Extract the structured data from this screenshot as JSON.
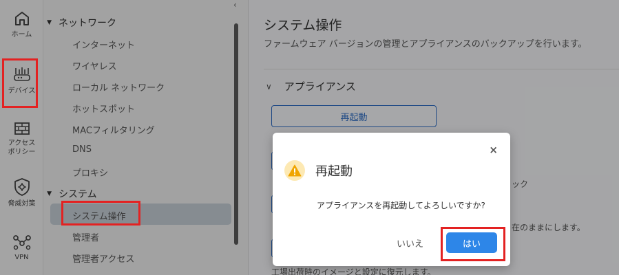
{
  "rail": {
    "items": [
      {
        "label": "ホーム",
        "icon": "home-icon"
      },
      {
        "label": "デバイス",
        "icon": "router-icon"
      },
      {
        "label": "アクセス\nポリシー",
        "label1": "アクセス",
        "label2": "ポリシー",
        "icon": "firewall-icon"
      },
      {
        "label": "脅威対策",
        "icon": "shield-icon"
      },
      {
        "label": "VPN",
        "icon": "vpn-icon"
      }
    ]
  },
  "nav": {
    "sections": [
      {
        "label": "ネットワーク",
        "items": [
          "インターネット",
          "ワイヤレス",
          "ローカル ネットワーク",
          "ホットスポット",
          "MACフィルタリング",
          "DNS",
          "プロキシ"
        ]
      },
      {
        "label": "システム",
        "items": [
          "システム操作",
          "管理者",
          "管理者アクセス"
        ]
      }
    ],
    "collapse_glyph": "‹"
  },
  "main": {
    "title": "システム操作",
    "subtitle": "ファームウェア バージョンの管理とアプライアンスのバックアップを行います。",
    "section_title": "アプライアンス",
    "reboot_button": "再起動",
    "fragments": {
      "f1": "ック",
      "f2": "在のままにします。",
      "f3": "工場出荷時のイメージと設定に復元します。"
    }
  },
  "dialog": {
    "title": "再起動",
    "message": "アプライアンスを再起動してよろしいですか?",
    "cancel_label": "いいえ",
    "confirm_label": "はい",
    "close_glyph": "×"
  },
  "colors": {
    "accent": "#2d86e8",
    "highlight": "#e32222",
    "warning_bg": "#fde9b3",
    "warning_fg": "#f0a500"
  }
}
